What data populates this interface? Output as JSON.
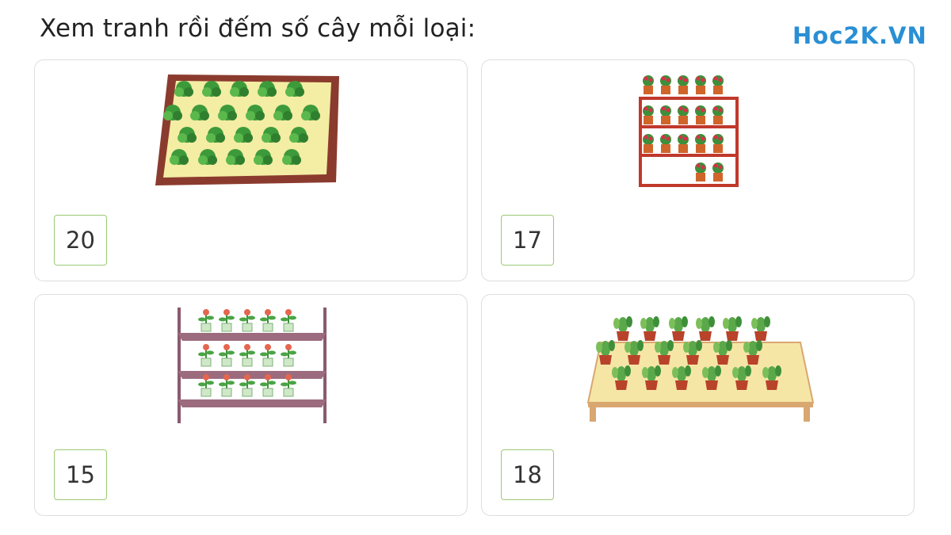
{
  "header": {
    "title": "Xem tranh rồi đếm số cây mỗi loại:",
    "logo_prefix": "Hoc2",
    "logo_suffix": "K.VN",
    "logo_color": "#2a8fd4"
  },
  "cards": [
    {
      "answer": "20",
      "picture": "garden-bed-icon"
    },
    {
      "answer": "17",
      "picture": "red-flower-pot-shelf-icon"
    },
    {
      "answer": "15",
      "picture": "potted-flower-shelf-icon"
    },
    {
      "answer": "18",
      "picture": "cactus-table-icon"
    }
  ],
  "colors": {
    "answer_border": "#9acb73",
    "card_border": "#dedede"
  }
}
